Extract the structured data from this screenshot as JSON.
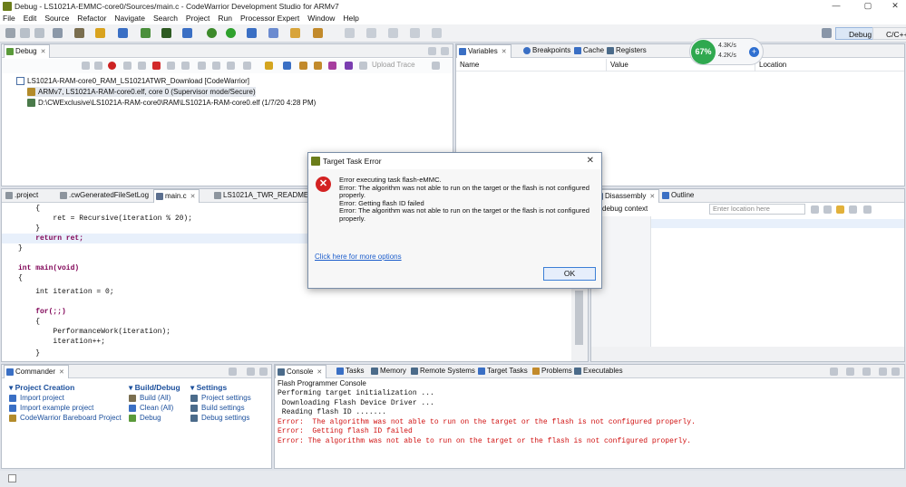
{
  "window": {
    "title": "Debug - LS1021A-EMMC-core0/Sources/main.c - CodeWarrior Development Studio for ARMv7",
    "controls": [
      "—",
      "▢",
      "✕"
    ]
  },
  "menu": [
    "File",
    "Edit",
    "Source",
    "Refactor",
    "Navigate",
    "Search",
    "Project",
    "Run",
    "Processor Expert",
    "Window",
    "Help"
  ],
  "perspectives": {
    "debug": "Debug",
    "cc": "C/C++"
  },
  "debug_view": {
    "tab": "Debug",
    "upload_trace": "Upload Trace",
    "tree": [
      "LS1021A-RAM-core0_RAM_LS1021ATWR_Download [CodeWarrior]",
      "ARMv7, LS1021A-RAM-core0.elf, core 0 (Supervisor mode/Secure)",
      "D:\\CWExclusive\\LS1021A-RAM-core0\\RAM\\LS1021A-RAM-core0.elf (1/7/20 4:28 PM)"
    ]
  },
  "variables_view": {
    "tabs": [
      "Variables",
      "Breakpoints",
      "Cache",
      "Registers"
    ],
    "columns": [
      "Name",
      "Value",
      "Location"
    ]
  },
  "network_widget": {
    "percent": "67%",
    "up": "4.3K/s",
    "down": "4.2K/s"
  },
  "editor": {
    "tabs": [
      ".project",
      ".cwGeneratedFileSetLog",
      "main.c",
      "LS1021A_TWR_README.txt"
    ],
    "lines": [
      "    {",
      "        ret = Recursive(iteration % 20);",
      "    }",
      "    return ret;",
      "}",
      "",
      "int main(void)",
      "{",
      "    int iteration = 0;",
      "",
      "    for(;;)",
      "    {",
      "        PerformanceWork(iteration);",
      "        iteration++;",
      "    }"
    ]
  },
  "disassembly_view": {
    "tabs": [
      "Disassembly",
      "Outline"
    ],
    "context": "debug context",
    "location_placeholder": "Enter location here"
  },
  "commander": {
    "tab": "Commander",
    "sections": [
      {
        "title": "Project Creation",
        "items": [
          "Import project",
          "Import example project",
          "CodeWarrior Bareboard Project"
        ]
      },
      {
        "title": "Build/Debug",
        "items": [
          "Build  (All)",
          "Clean  (All)",
          "Debug"
        ]
      },
      {
        "title": "Settings",
        "items": [
          "Project settings",
          "Build settings",
          "Debug settings"
        ]
      }
    ]
  },
  "console": {
    "tabs": [
      "Console",
      "Tasks",
      "Memory",
      "Remote Systems",
      "Target Tasks",
      "Problems",
      "Executables"
    ],
    "header": "Flash Programmer Console",
    "lines": [
      {
        "text": "Performing target initialization ...",
        "error": false
      },
      {
        "text": " Downloading Flash Device Driver ...",
        "error": false
      },
      {
        "text": " Reading flash ID .......",
        "error": false
      },
      {
        "text": "Error:  The algorithm was not able to run on the target or the flash is not configured properly.",
        "error": true
      },
      {
        "text": "Error:  Getting flash ID failed",
        "error": true
      },
      {
        "text": "Error: The algorithm was not able to run on the target or the flash is not configured properly.",
        "error": true
      }
    ]
  },
  "dialog": {
    "title": "Target Task Error",
    "message_lines": [
      "Error executing task flash-eMMC.",
      "Error:  The algorithm was not able to run on the target or the flash is not configured properly.",
      "Error:  Getting flash ID failed",
      "Error:  The algorithm was not able to run on the target or the flash is not configured properly."
    ],
    "link": "Click here for more options",
    "ok": "OK"
  },
  "colors": {
    "accent": "#3c7fd6",
    "error": "#d01010",
    "keyword": "#7f0055",
    "link": "#1f5fcc"
  }
}
